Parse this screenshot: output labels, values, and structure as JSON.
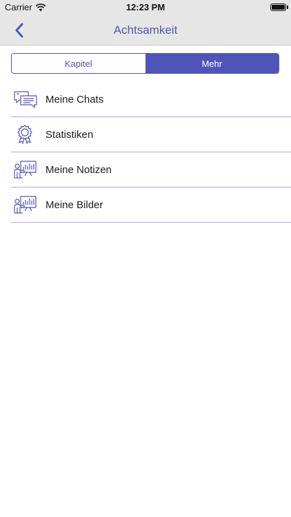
{
  "status_bar": {
    "carrier": "Carrier",
    "time": "12:23 PM",
    "wifi_icon": "wifi-icon",
    "battery_icon": "battery-icon"
  },
  "nav": {
    "title": "Achtsamkeit",
    "back_icon": "chevron-left-icon"
  },
  "segments": [
    {
      "label": "Kapitel",
      "active": false
    },
    {
      "label": "Mehr",
      "active": true
    }
  ],
  "menu": {
    "items": [
      {
        "label": "Meine Chats",
        "icon": "chat-bubbles-icon"
      },
      {
        "label": "Statistiken",
        "icon": "award-badge-icon"
      },
      {
        "label": "Meine Notizen",
        "icon": "presentation-board-icon"
      },
      {
        "label": "Meine Bilder",
        "icon": "presentation-board-icon"
      }
    ]
  },
  "colors": {
    "accent": "#4f55b8",
    "title": "#5257b5",
    "separator": "#a9abd8",
    "bar_background": "#e6e6e6"
  }
}
